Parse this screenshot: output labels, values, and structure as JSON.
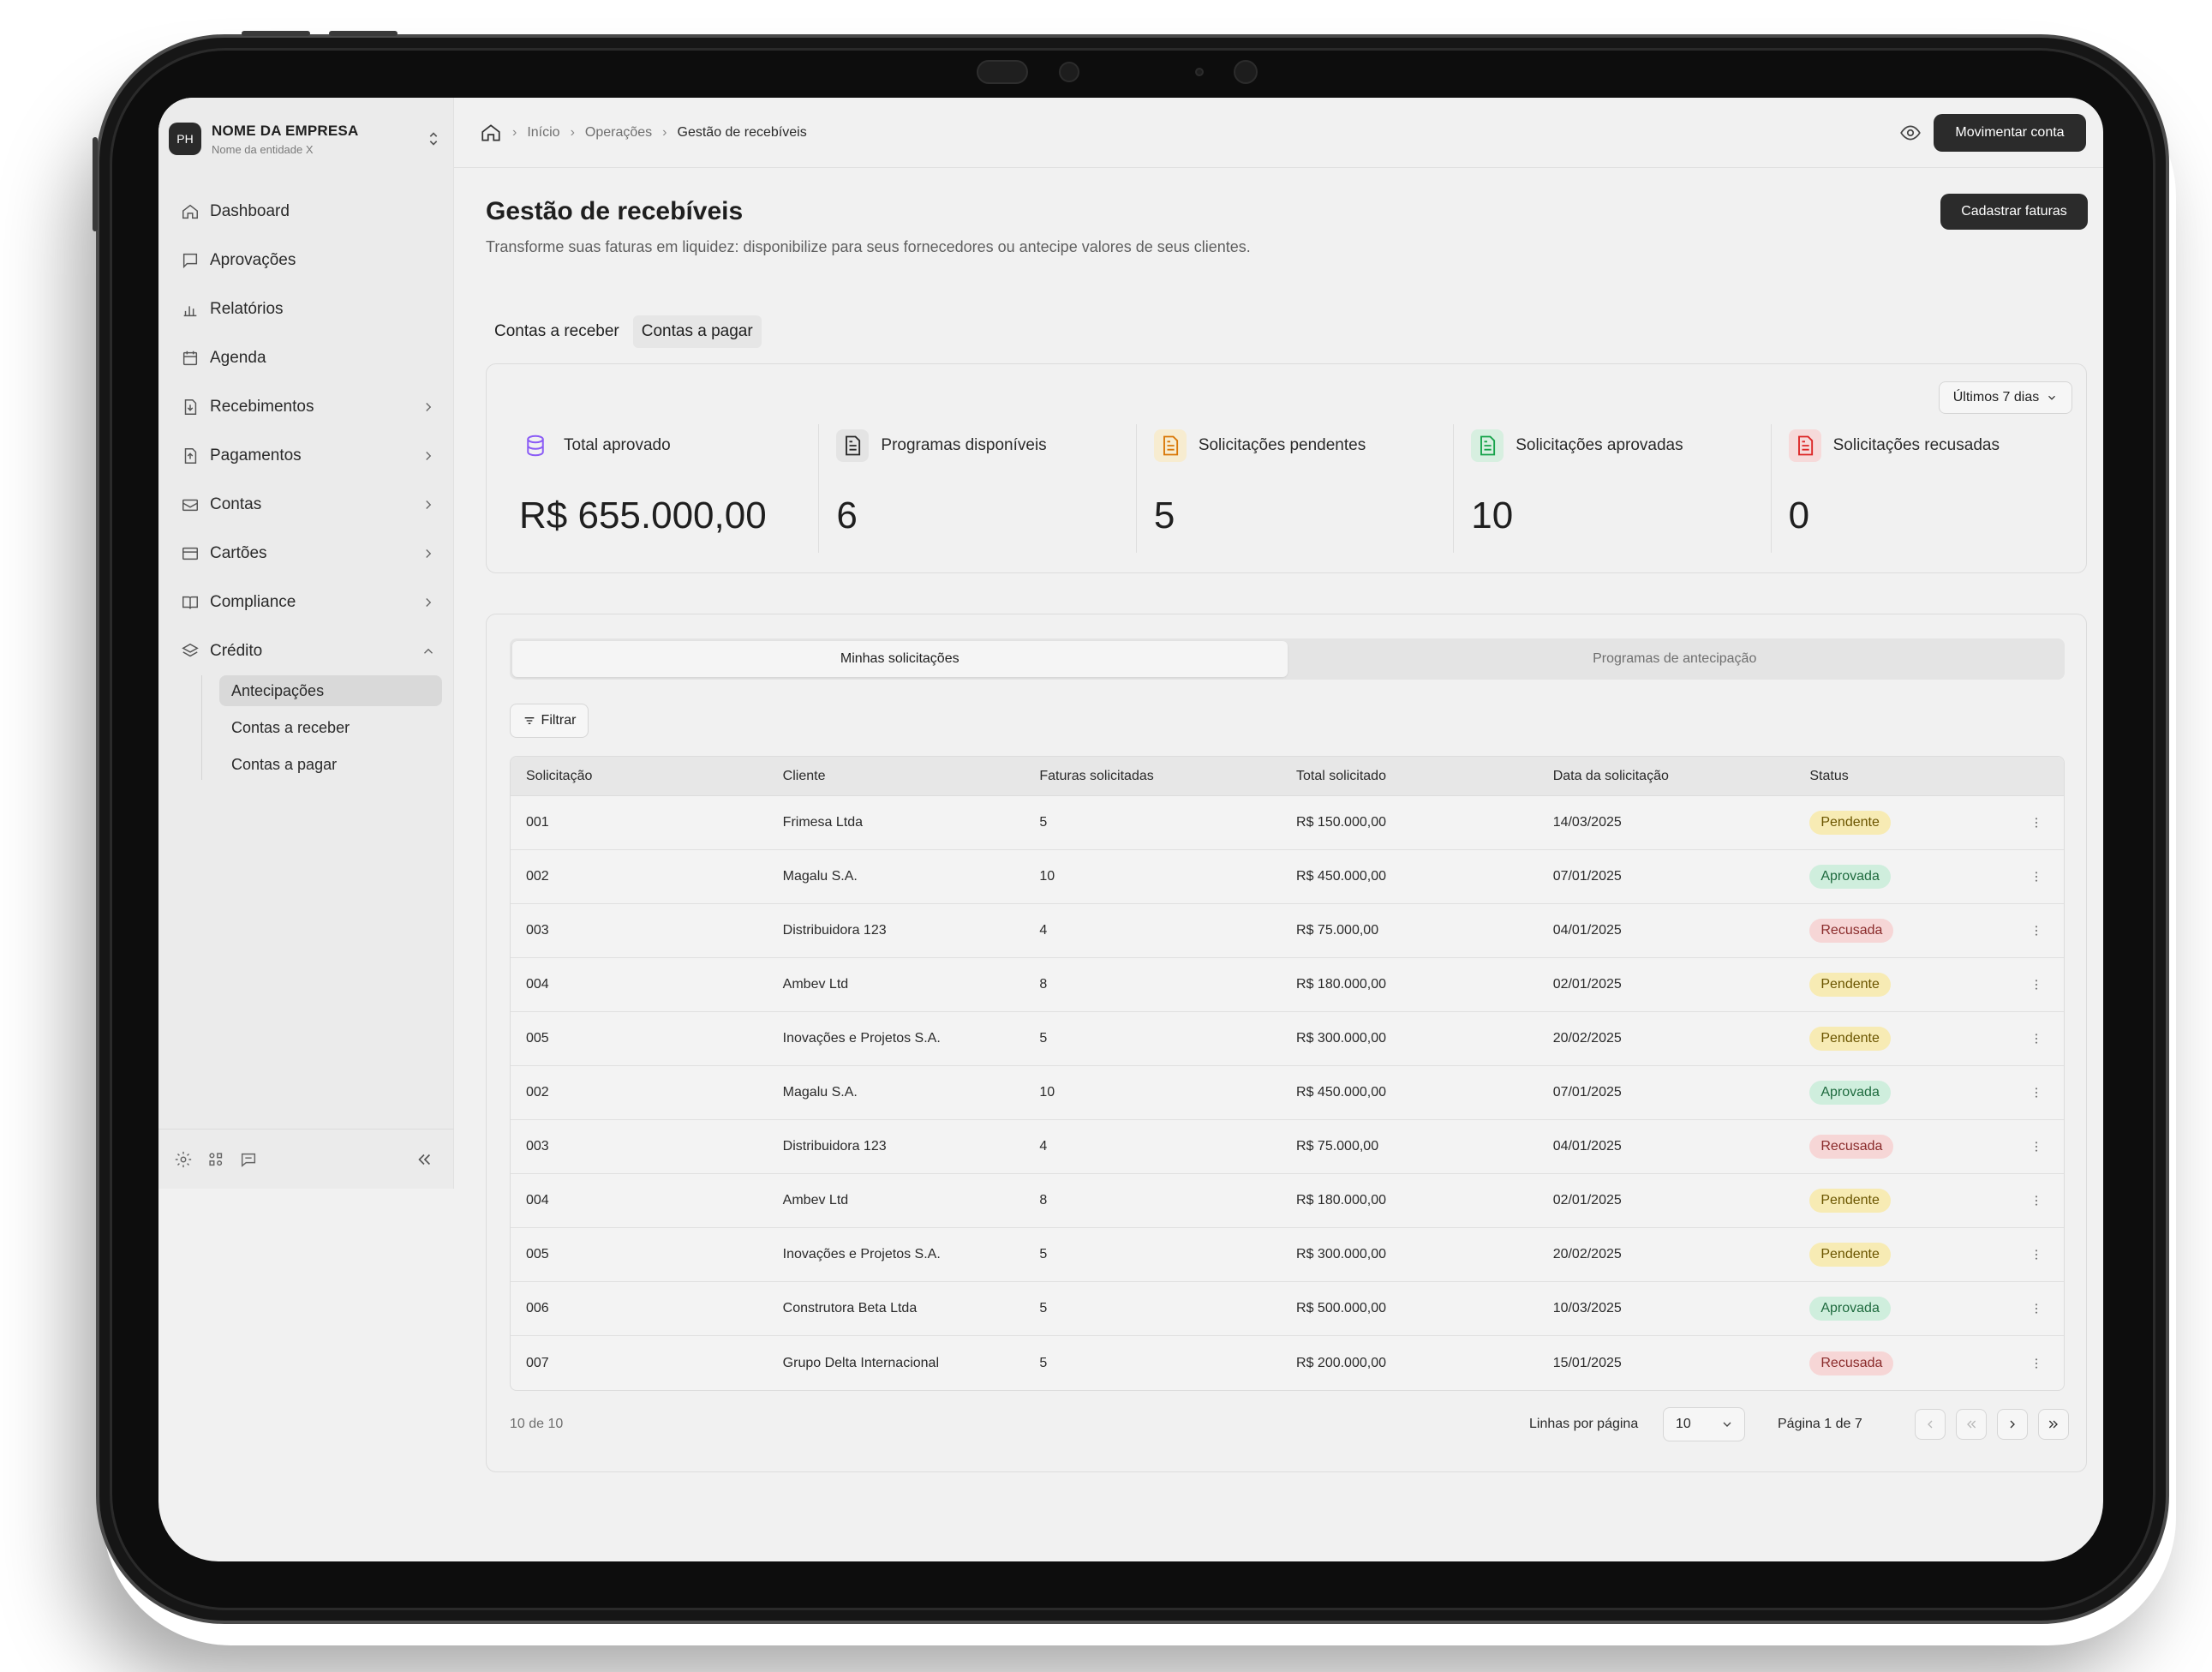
{
  "company": {
    "initials": "PH",
    "name": "NOME DA EMPRESA",
    "entity": "Nome da entidade X"
  },
  "nav": {
    "items": [
      {
        "label": "Dashboard",
        "icon": "home-icon"
      },
      {
        "label": "Aprovações",
        "icon": "approval-icon"
      },
      {
        "label": "Relatórios",
        "icon": "chart-icon"
      },
      {
        "label": "Agenda",
        "icon": "calendar-icon"
      },
      {
        "label": "Recebimentos",
        "icon": "receive-icon"
      },
      {
        "label": "Pagamentos",
        "icon": "payment-icon"
      },
      {
        "label": "Contas",
        "icon": "account-icon"
      },
      {
        "label": "Cartões",
        "icon": "card-icon"
      },
      {
        "label": "Compliance",
        "icon": "book-icon"
      },
      {
        "label": "Crédito",
        "icon": "layers-icon"
      }
    ],
    "credit_sub": [
      "Antecipações",
      "Contas a receber",
      "Contas a pagar"
    ]
  },
  "breadcrumb": {
    "home": "Início",
    "section": "Operações",
    "current": "Gestão de recebíveis"
  },
  "actions": {
    "move_account": "Movimentar conta",
    "register_invoices": "Cadastrar faturas"
  },
  "page": {
    "title": "Gestão de recebíveis",
    "description": "Transforme suas faturas em liquidez: disponibilize para seus fornecedores ou antecipe valores de seus clientes."
  },
  "top_tabs": [
    "Contas a receber",
    "Contas a pagar"
  ],
  "period": "Últimos 7 dias",
  "stats": [
    {
      "label": "Total aprovado",
      "value": "R$ 655.000,00",
      "icon": "database-icon",
      "color": "#8b5cf6"
    },
    {
      "label": "Programas disponíveis",
      "value": "6",
      "icon": "document-icon",
      "color": "#2a2a2a"
    },
    {
      "label": "Solicitações pendentes",
      "value": "5",
      "icon": "file-pending-icon",
      "color": "#d97706"
    },
    {
      "label": "Solicitações aprovadas",
      "value": "10",
      "icon": "file-approved-icon",
      "color": "#16a34a"
    },
    {
      "label": "Solicitações recusadas",
      "value": "0",
      "icon": "file-rejected-icon",
      "color": "#dc2626"
    }
  ],
  "list_tabs": [
    "Minhas solicitações",
    "Programas de antecipação"
  ],
  "filter_label": "Filtrar",
  "table": {
    "headers": [
      "Solicitação",
      "Cliente",
      "Faturas solicitadas",
      "Total solicitado",
      "Data  da solicitação",
      "Status"
    ],
    "rows": [
      [
        "001",
        "Frimesa Ltda",
        "5",
        "R$ 150.000,00",
        "14/03/2025",
        "Pendente"
      ],
      [
        "002",
        "Magalu S.A.",
        "10",
        "R$ 450.000,00",
        "07/01/2025",
        "Aprovada"
      ],
      [
        "003",
        "Distribuidora 123",
        "4",
        "R$ 75.000,00",
        "04/01/2025",
        "Recusada"
      ],
      [
        "004",
        "Ambev Ltd",
        "8",
        "R$ 180.000,00",
        "02/01/2025",
        "Pendente"
      ],
      [
        "005",
        "Inovações e Projetos S.A.",
        "5",
        "R$ 300.000,00",
        "20/02/2025",
        "Pendente"
      ],
      [
        "002",
        "Magalu S.A.",
        "10",
        "R$ 450.000,00",
        "07/01/2025",
        "Aprovada"
      ],
      [
        "003",
        "Distribuidora 123",
        "4",
        "R$ 75.000,00",
        "04/01/2025",
        "Recusada"
      ],
      [
        "004",
        "Ambev Ltd",
        "8",
        "R$ 180.000,00",
        "02/01/2025",
        "Pendente"
      ],
      [
        "005",
        "Inovações e Projetos S.A.",
        "5",
        "R$ 300.000,00",
        "20/02/2025",
        "Pendente"
      ],
      [
        "006",
        "Construtora Beta Ltda",
        "5",
        "R$ 500.000,00",
        "10/03/2025",
        "Aprovada"
      ],
      [
        "007",
        "Grupo Delta Internacional",
        "5",
        "R$ 200.000,00",
        "15/01/2025",
        "Recusada"
      ]
    ]
  },
  "pagination": {
    "count": "10 de 10",
    "rows_label": "Linhas por página",
    "rows_value": "10",
    "page_label": "Página 1 de 7"
  }
}
